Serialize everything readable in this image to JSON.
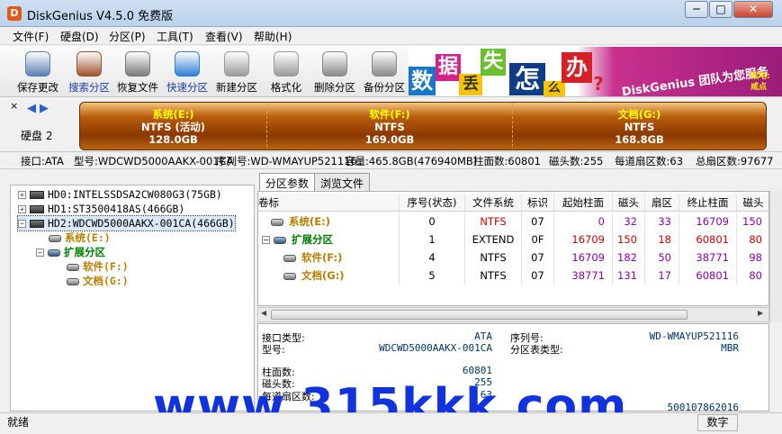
{
  "window": {
    "title": "DiskGenius V4.5.0 免费版",
    "app_icon": "D",
    "minimize": "─",
    "maximize": "□",
    "close": "✕"
  },
  "menu": [
    "文件(F)",
    "硬盘(D)",
    "分区(P)",
    "工具(T)",
    "查看(V)",
    "帮助(H)"
  ],
  "toolbar": [
    {
      "label": "保存更改",
      "icon": "save-icon",
      "color": "#5a7fb5"
    },
    {
      "label": "搜索分区",
      "icon": "magnifier-icon",
      "color": "#a0522d",
      "active": true
    },
    {
      "label": "恢复文件",
      "icon": "recover-icon",
      "color": "#7a7a7a"
    },
    {
      "label": "快速分区",
      "icon": "quick-partition-icon",
      "color": "#2f7fd3",
      "active": true
    },
    {
      "label": "新建分区",
      "icon": "new-partition-icon",
      "color": "#9a9a9a"
    },
    {
      "label": "格式化",
      "icon": "format-icon",
      "color": "#9a9a9a"
    },
    {
      "label": "删除分区",
      "icon": "delete-icon",
      "color": "#8a8a8a"
    },
    {
      "label": "备份分区",
      "icon": "backup-icon",
      "color": "#8a8a8a"
    }
  ],
  "banner": {
    "chars": [
      "数",
      "据",
      "丢",
      "失",
      "怎",
      "么",
      "办",
      "?"
    ],
    "slogan": "DiskGenius 团队为您服务",
    "side1": "致电:",
    "side2": "咸点"
  },
  "disk": {
    "label": "硬盘 2",
    "close": "×",
    "prev": "◀",
    "next": "▶"
  },
  "partitions_bar": [
    {
      "name": "系统(E:)",
      "fs": "NTFS (活动)",
      "size": "128.0GB"
    },
    {
      "name": "软件(F:)",
      "fs": "NTFS",
      "size": "169.0GB"
    },
    {
      "name": "文档(G:)",
      "fs": "NTFS",
      "size": "168.8GB"
    }
  ],
  "infobar": {
    "interface": "接口:ATA",
    "model": "型号:WDCWD5000AAKX-001CA",
    "serial": "序列号:WD-WMAYUP521116",
    "capacity": "容量:465.8GB(476940MB)",
    "cylinders": "柱面数:60801",
    "heads": "磁头数:255",
    "sectors_per_track": "每道扇区数:63",
    "total_sectors": "总扇区数:97677"
  },
  "tree": {
    "disks": [
      "HD0:INTELSSDSA2CW080G3(75GB)",
      "HD1:ST3500418AS(466GB)",
      "HD2:WDCWD5000AAKX-001CA(466GB)"
    ],
    "partitions": [
      "系统(E:)",
      "扩展分区",
      "软件(F:)",
      "文档(G:)"
    ],
    "expand_plus": "+",
    "expand_minus": "−"
  },
  "tabs": [
    "分区参数",
    "浏览文件"
  ],
  "table": {
    "headers": [
      "卷标",
      "序号(状态)",
      "文件系统",
      "标识",
      "起始柱面",
      "磁头",
      "扇区",
      "终止柱面",
      "磁头"
    ],
    "rows": [
      [
        "系统(E:)",
        "0",
        "NTFS",
        "07",
        "0",
        "32",
        "33",
        "16709",
        "150"
      ],
      [
        "扩展分区",
        "1",
        "EXTEND",
        "0F",
        "16709",
        "150",
        "18",
        "60801",
        "80"
      ],
      [
        "软件(F:)",
        "4",
        "NTFS",
        "07",
        "16709",
        "182",
        "50",
        "38771",
        "98"
      ],
      [
        "文档(G:)",
        "5",
        "NTFS",
        "07",
        "38771",
        "131",
        "17",
        "60801",
        "80"
      ]
    ]
  },
  "details": {
    "iface_label": "接口类型:",
    "iface_value": "ATA",
    "model_label": "型号:",
    "model_value": "WDCWD5000AAKX-001CA",
    "serial_label": "序列号:",
    "serial_value": "WD-WMAYUP521116",
    "ptype_label": "分区表类型:",
    "ptype_value": "MBR",
    "cyl_label": "柱面数:",
    "cyl_value": "60801",
    "heads_label": "磁头数:",
    "heads_value": "255",
    "spt_label": "每道扇区数:",
    "spt_value": "63",
    "total_partial": "500107862016"
  },
  "watermark": "www.315kkk.com",
  "status": {
    "text": "就绪",
    "numlock": "数字"
  }
}
